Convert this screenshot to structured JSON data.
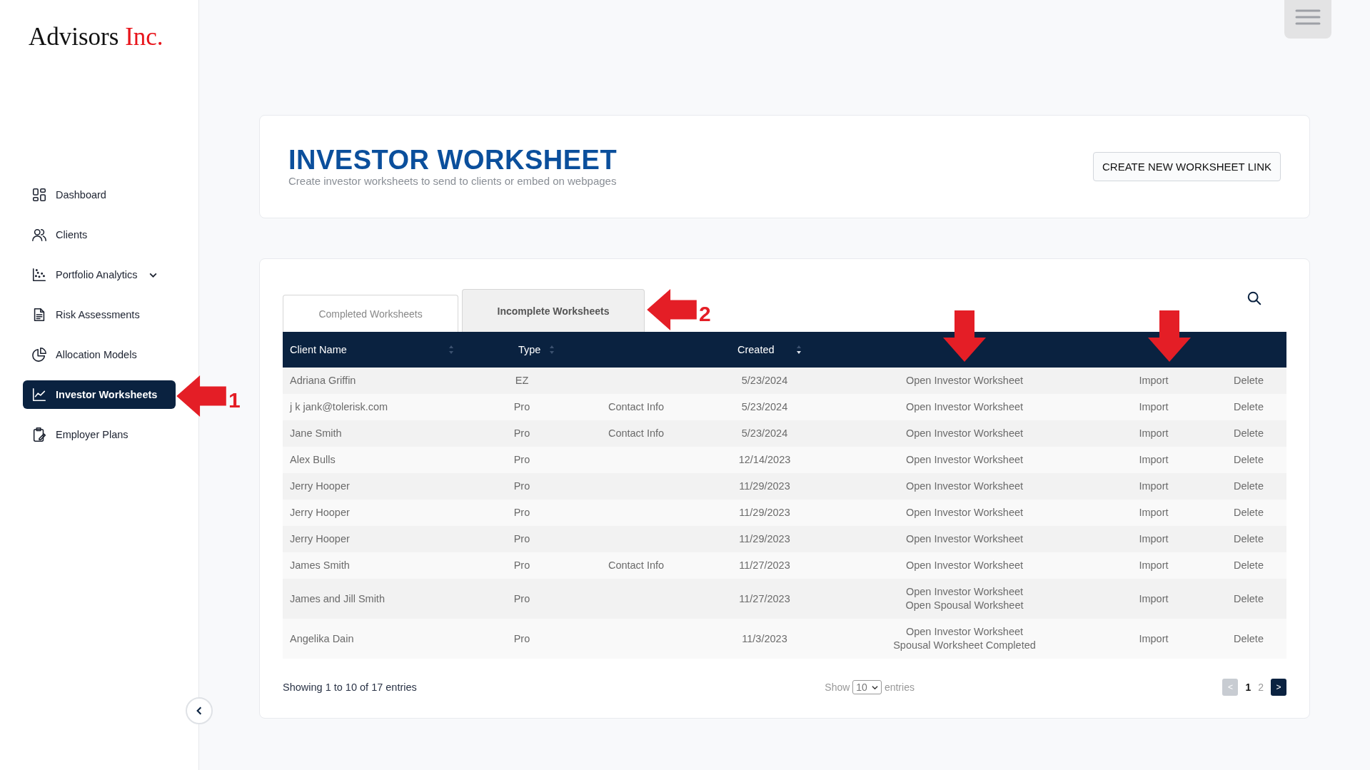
{
  "logo": {
    "name": "Advisors",
    "suffix": "Inc."
  },
  "sidebar": {
    "items": [
      {
        "label": "Dashboard",
        "selected": false
      },
      {
        "label": "Clients",
        "selected": false
      },
      {
        "label": "Portfolio Analytics",
        "selected": false,
        "expandable": true
      },
      {
        "label": "Risk Assessments",
        "selected": false
      },
      {
        "label": "Allocation Models",
        "selected": false
      },
      {
        "label": "Investor Worksheets",
        "selected": true,
        "annotation": "1"
      },
      {
        "label": "Employer Plans",
        "selected": false
      }
    ]
  },
  "header": {
    "title": "INVESTOR WORKSHEET",
    "subtitle": "Create investor worksheets to send to clients or embed on webpages",
    "button": "CREATE NEW WORKSHEET LINK"
  },
  "tabs": [
    {
      "label": "Completed Worksheets",
      "selected": false
    },
    {
      "label": "Incomplete Worksheets",
      "selected": true,
      "annotation": "2"
    }
  ],
  "table": {
    "columns": [
      {
        "label": "Client Name",
        "sorted": false
      },
      {
        "label": "Type",
        "sorted": false
      },
      {
        "label": "Created",
        "sorted": true
      }
    ],
    "header_arrows": [
      {
        "kind": "down"
      },
      {
        "kind": "down"
      }
    ],
    "rows": [
      {
        "name": "Adriana Griffin",
        "type": "EZ",
        "created": "5/23/2024",
        "links": [
          "Open Investor Worksheet"
        ],
        "import": "Import",
        "delete": "Delete"
      },
      {
        "name": "j k jank@tolerisk.com",
        "type": "Pro",
        "contact": "Contact Info",
        "created": "5/23/2024",
        "links": [
          "Open Investor Worksheet"
        ],
        "import": "Import",
        "delete": "Delete"
      },
      {
        "name": "Jane Smith",
        "type": "Pro",
        "contact": "Contact Info",
        "created": "5/23/2024",
        "links": [
          "Open Investor Worksheet"
        ],
        "import": "Import",
        "delete": "Delete"
      },
      {
        "name": "Alex Bulls",
        "type": "Pro",
        "created": "12/14/2023",
        "links": [
          "Open Investor Worksheet"
        ],
        "import": "Import",
        "delete": "Delete"
      },
      {
        "name": "Jerry Hooper",
        "type": "Pro",
        "created": "11/29/2023",
        "links": [
          "Open Investor Worksheet"
        ],
        "import": "Import",
        "delete": "Delete"
      },
      {
        "name": "Jerry Hooper",
        "type": "Pro",
        "created": "11/29/2023",
        "links": [
          "Open Investor Worksheet"
        ],
        "import": "Import",
        "delete": "Delete"
      },
      {
        "name": "Jerry Hooper",
        "type": "Pro",
        "created": "11/29/2023",
        "links": [
          "Open Investor Worksheet"
        ],
        "import": "Import",
        "delete": "Delete"
      },
      {
        "name": "James Smith",
        "type": "Pro",
        "contact": "Contact Info",
        "created": "11/27/2023",
        "links": [
          "Open Investor Worksheet"
        ],
        "import": "Import",
        "delete": "Delete"
      },
      {
        "name": "James and Jill Smith",
        "type": "Pro",
        "created": "11/27/2023",
        "links": [
          "Open Investor Worksheet",
          "Open Spousal Worksheet"
        ],
        "import": "Import",
        "delete": "Delete"
      },
      {
        "name": "Angelika Dain",
        "type": "Pro",
        "created": "11/3/2023",
        "links": [
          "Open Investor Worksheet",
          "Spousal Worksheet Completed"
        ],
        "import": "Import",
        "delete": "Delete"
      }
    ]
  },
  "footer": {
    "info": "Showing 1 to 10 of 17 entries",
    "show_label": "Show",
    "page_size": "10",
    "entries_label": "entries",
    "prev": {
      "label": "<",
      "disabled": true
    },
    "pages": [
      {
        "label": "1",
        "selected": true
      },
      {
        "label": "2",
        "selected": false
      }
    ],
    "next": {
      "label": ">",
      "disabled": false
    }
  }
}
